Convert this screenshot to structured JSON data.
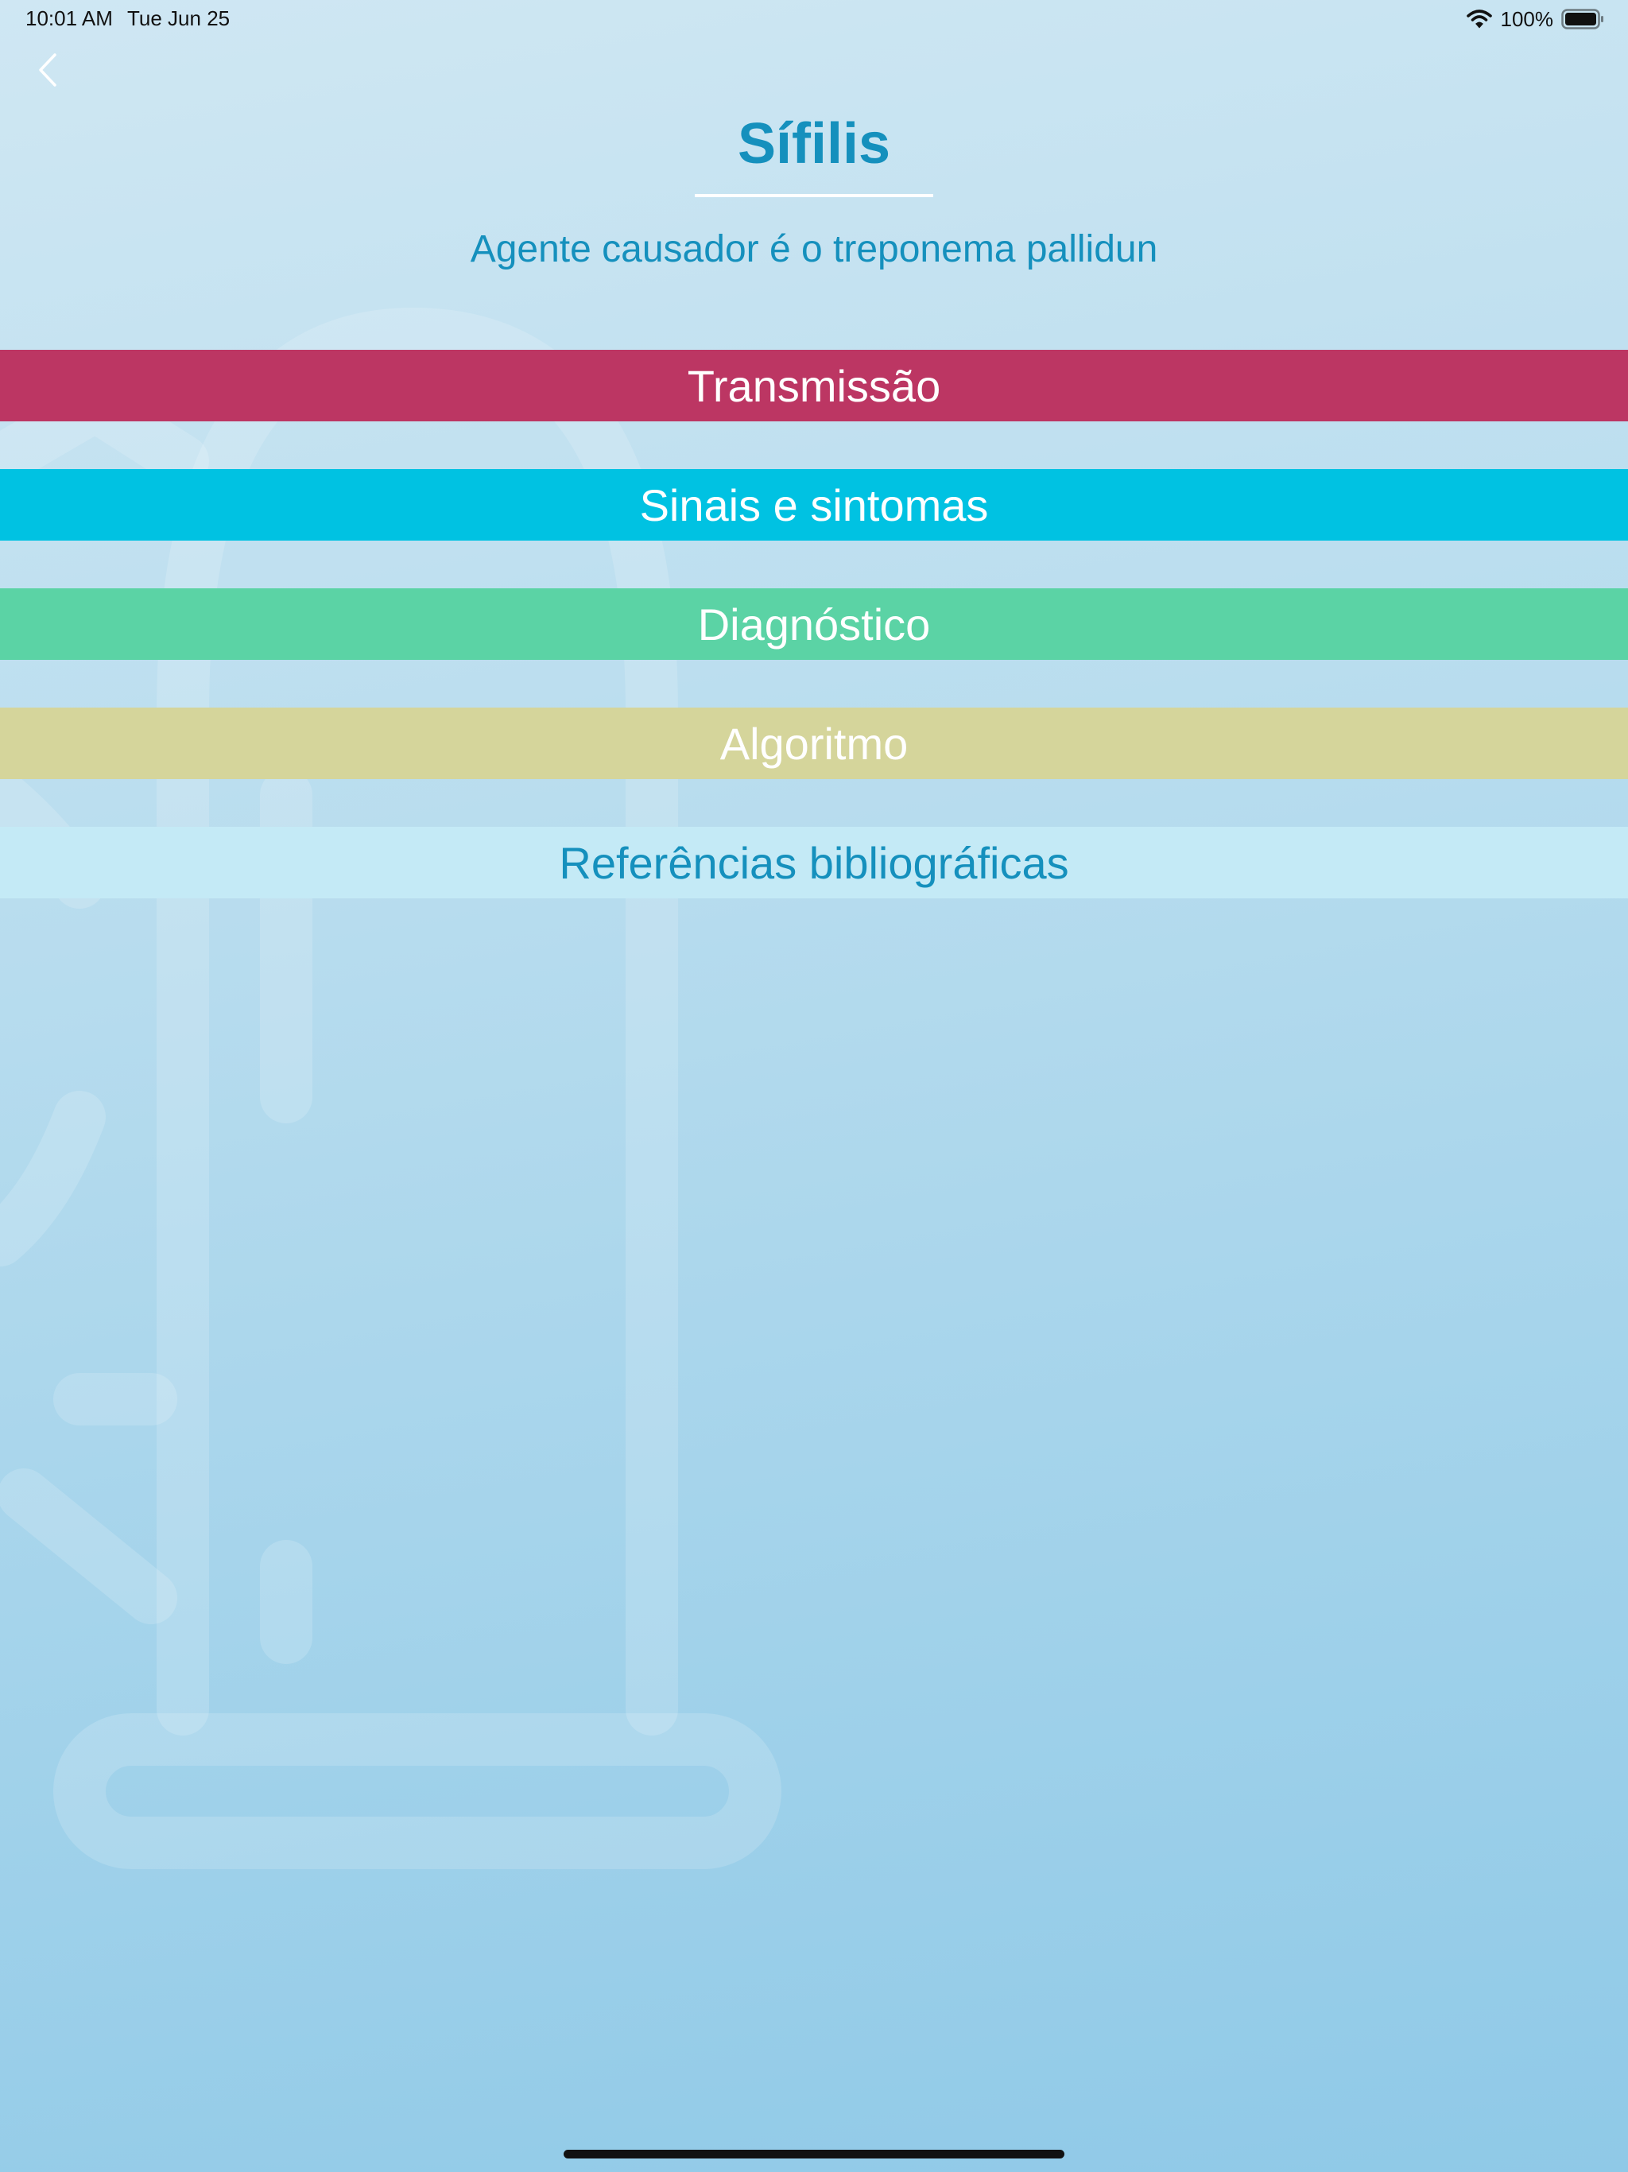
{
  "status_bar": {
    "time": "10:01 AM",
    "date": "Tue Jun 25",
    "battery": "100%"
  },
  "header": {
    "back_icon": "chevron-left-icon",
    "title": "Sífilis",
    "subtitle": "Agente causador é o treponema pallidun"
  },
  "menu": {
    "items": [
      {
        "label": "Transmissão",
        "color": "#bc3663",
        "text_color": "#ffffff"
      },
      {
        "label": "Sinais e sintomas",
        "color": "#00c2e2",
        "text_color": "#ffffff"
      },
      {
        "label": "Diagnóstico",
        "color": "#5bd3a5",
        "text_color": "#ffffff"
      },
      {
        "label": "Algoritmo",
        "color": "#d5d59b",
        "text_color": "#ffffff"
      },
      {
        "label": "Referências bibliográficas",
        "color": "#c4eaf6",
        "text_color": "#1590bd"
      }
    ]
  },
  "colors": {
    "accent": "#1590bd",
    "background_top": "#cfe7f3",
    "background_bottom": "#8fc9e7"
  }
}
